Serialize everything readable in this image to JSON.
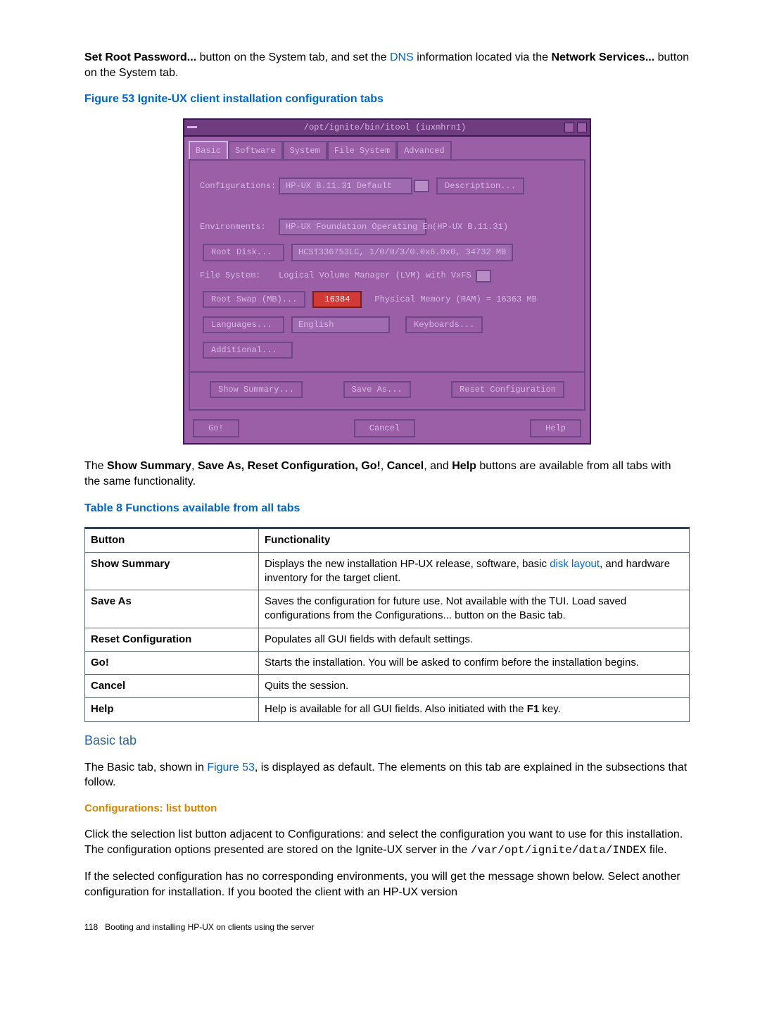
{
  "intro": {
    "pre1": "Set Root Password...",
    "mid1": " button on the System tab, and set the ",
    "dns": "DNS",
    "mid2": " information located via the ",
    "netsvc": "Network Services...",
    "tail": " button on the System tab."
  },
  "fig53": "Figure 53 Ignite-UX client installation configuration tabs",
  "shot": {
    "title": "/opt/ignite/bin/itool (iuxmhrn1)",
    "tabs": [
      "Basic",
      "Software",
      "System",
      "File System",
      "Advanced"
    ],
    "cfg_lbl": "Configurations:",
    "cfg_val": "HP-UX B.11.31 Default",
    "desc_btn": "Description...",
    "env_lbl": "Environments:",
    "env_val": "HP-UX Foundation Operating En",
    "env_note": "(HP-UX B.11.31)",
    "root_btn": "Root Disk...",
    "root_val": "HCST336753LC, 1/0/0/3/0.0x6.0x0, 34732 MB",
    "fs_lbl": "File System:",
    "fs_val": "Logical Volume Manager (LVM) with VxFS",
    "rswap_btn": "Root Swap (MB)...",
    "rswap_val": "16384",
    "ram_lbl": "Physical Memory (RAM) = 16363 MB",
    "lang_btn": "Languages...",
    "lang_val": "English",
    "kbd_btn": "Keyboards...",
    "add_btn": "Additional...",
    "summary": "Show Summary...",
    "saveas": "Save As...",
    "reset": "Reset Configuration",
    "go": "Go!",
    "cancel": "Cancel",
    "help": "Help"
  },
  "after_fig_p1": {
    "a": "The ",
    "b": "Show Summary",
    "c": ", ",
    "d": "Save As, Reset Configuration, Go!",
    "e": ", ",
    "f": "Cancel",
    "g": ", and ",
    "h": "Help",
    "i": "  buttons are available from all tabs with the same functionality."
  },
  "table8_caption": "Table 8 Functions available from all tabs",
  "table8": {
    "h1": "Button",
    "h2": "Functionality",
    "rows": [
      {
        "b": "Show Summary",
        "f_pre": "Displays the new installation HP-UX release, software, basic ",
        "f_link": "disk layout",
        "f_post": ", and hardware inventory for the target client."
      },
      {
        "b": "Save As",
        "f": "Saves the configuration for future use. Not available with the TUI. Load saved configurations from the Configurations... button on the Basic tab."
      },
      {
        "b": "Reset Configuration",
        "f": "Populates all GUI fields with default settings."
      },
      {
        "b": "Go!",
        "f": "Starts the installation. You will be asked to confirm before the installation begins."
      },
      {
        "b": "Cancel",
        "f": "Quits the session."
      },
      {
        "b": "Help",
        "f_pre": "Help is available for all GUI fields. Also initiated with the ",
        "f_bold": "F1",
        "f_post": " key."
      }
    ]
  },
  "basic_heading": "Basic tab",
  "basic_p1_a": "The Basic tab, shown in ",
  "basic_p1_link": "Figure 53",
  "basic_p1_b": ", is displayed as default. The elements on this tab are explained in the subsections that follow.",
  "cfg_heading": "Configurations: list button",
  "cfg_p1_a": "Click the selection list button adjacent to Configurations: and select the configuration you want to use for this installation. The configuration options presented are stored on the Ignite-UX server in the ",
  "cfg_p1_code": "/var/opt/ignite/data/INDEX",
  "cfg_p1_b": " file.",
  "cfg_p2": "If the selected configuration has no corresponding environments, you will get the message shown below. Select another configuration for installation. If you booted the client with an HP-UX version",
  "footer_page": "118",
  "footer_text": "Booting and installing HP-UX on clients using the server"
}
